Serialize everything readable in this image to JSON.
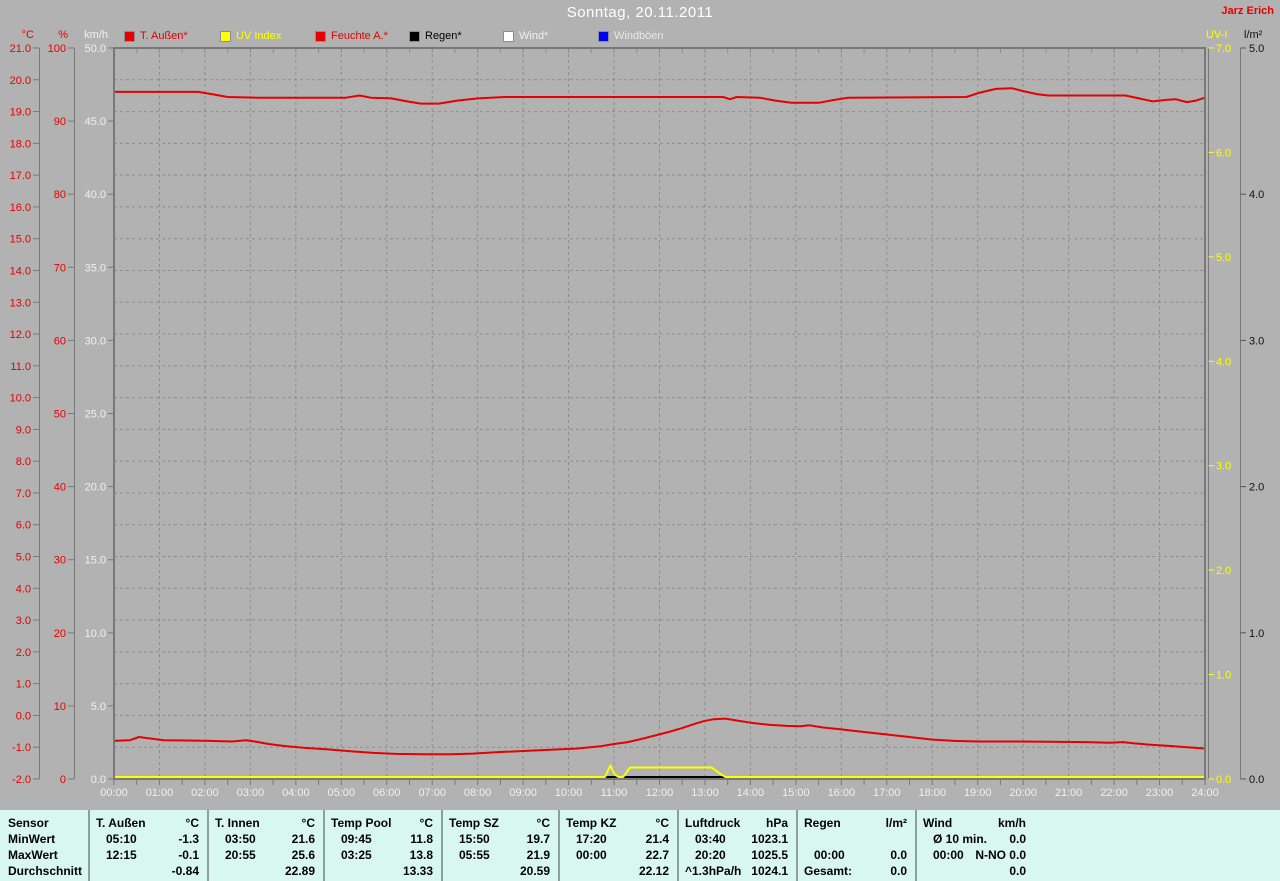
{
  "header": {
    "title": "Sonntag, 20.11.2011",
    "credit": "Jarz Erich"
  },
  "theme": {
    "background": "#b2b2b2",
    "plot_border": "#787878",
    "grid": "#8d8d8d",
    "table_background": "#d8f7f0",
    "red": "#e60000",
    "yellow": "#ffff00",
    "white": "#ffffff",
    "blue": "#0000ff",
    "black": "#000000",
    "x_label_color": "#f0f0f0"
  },
  "legend": {
    "items": [
      {
        "id": "t-aussen",
        "label": "T. Außen*",
        "swatch_color": "#e60000",
        "text_color": "#e60000"
      },
      {
        "id": "uv-index",
        "label": "UV Index",
        "swatch_color": "#ffff00",
        "text_color": "#ffff00"
      },
      {
        "id": "feuchte-a",
        "label": "Feuchte A.*",
        "swatch_color": "#e60000",
        "text_color": "#e60000"
      },
      {
        "id": "regen",
        "label": "Regen*",
        "swatch_color": "#000000",
        "text_color": "#000000"
      },
      {
        "id": "wind",
        "label": "Wind*",
        "swatch_color": "#ffffff",
        "text_color": "#f0f0f0"
      },
      {
        "id": "windboeen",
        "label": "Windböen",
        "swatch_color": "#0000ff",
        "text_color": "#e8e8e8"
      }
    ]
  },
  "chart_data": {
    "type": "line",
    "title": "Sonntag, 20.11.2011",
    "x_axis": {
      "min": 0,
      "max": 24,
      "grid_step_hours": 1,
      "tick_step_hours": 0.5,
      "labels": [
        "00:00",
        "01:00",
        "02:00",
        "03:00",
        "04:00",
        "05:00",
        "06:00",
        "07:00",
        "08:00",
        "09:00",
        "10:00",
        "11:00",
        "12:00",
        "13:00",
        "14:00",
        "15:00",
        "16:00",
        "17:00",
        "18:00",
        "19:00",
        "20:00",
        "21:00",
        "22:00",
        "23:00",
        "24:00"
      ]
    },
    "axes": {
      "temp": {
        "label": "°C",
        "side": "left",
        "min": -2,
        "max": 21,
        "step": 1,
        "color": "#e60000",
        "tick_labels": [
          "21.0",
          "20.0",
          "19.0",
          "18.0",
          "17.0",
          "16.0",
          "15.0",
          "14.0",
          "13.0",
          "12.0",
          "11.0",
          "10.0",
          "9.0",
          "8.0",
          "7.0",
          "6.0",
          "5.0",
          "4.0",
          "3.0",
          "2.0",
          "1.0",
          "0.0",
          "-1.0",
          "-2.0"
        ]
      },
      "humidity": {
        "label": "%",
        "side": "left",
        "min": 0,
        "max": 100,
        "step": 10,
        "color": "#e60000",
        "tick_labels": [
          "100",
          "90",
          "80",
          "70",
          "60",
          "50",
          "40",
          "30",
          "20",
          "10",
          "0"
        ]
      },
      "windspeed": {
        "label": "km/h",
        "side": "left",
        "min": 0,
        "max": 50,
        "step": 5,
        "color": "#f0f0f0",
        "tick_labels": [
          "50.0",
          "45.0",
          "40.0",
          "35.0",
          "30.0",
          "25.0",
          "20.0",
          "15.0",
          "10.0",
          "5.0",
          "0.0"
        ]
      },
      "uv": {
        "label": "UV-I",
        "side": "right",
        "min": 0,
        "max": 7,
        "step": 1,
        "color": "#ffff00",
        "tick_labels": [
          "7.0",
          "6.0",
          "5.0",
          "4.0",
          "3.0",
          "2.0",
          "1.0",
          "0.0"
        ]
      },
      "rain": {
        "label": "l/m²",
        "side": "right",
        "min": 0,
        "max": 5,
        "step": 1,
        "color": "#111111",
        "tick_labels": [
          "5.0",
          "4.0",
          "3.0",
          "2.0",
          "1.0",
          "0.0"
        ]
      }
    },
    "grid": {
      "horizontal_step_temp": 1,
      "vertical_step_hours": 1,
      "style": "dashed"
    },
    "series": [
      {
        "name": "Windböen",
        "axis": "windspeed",
        "color": "#0000ff",
        "width": 2,
        "points": [
          [
            0,
            0
          ],
          [
            24,
            0
          ]
        ]
      },
      {
        "name": "Wind*",
        "axis": "windspeed",
        "color": "#ffffff",
        "width": 2,
        "points": [
          [
            0,
            0
          ],
          [
            24,
            0
          ]
        ]
      },
      {
        "name": "Regen*",
        "axis": "rain",
        "color": "#000000",
        "width": 2,
        "points": [
          [
            0,
            0
          ],
          [
            24,
            0
          ]
        ]
      },
      {
        "name": "UV Index",
        "axis": "uv",
        "color": "#ffff00",
        "width": 2,
        "points": [
          [
            0,
            0
          ],
          [
            10.8,
            0
          ],
          [
            10.92,
            0.13
          ],
          [
            11.02,
            0.04
          ],
          [
            11.1,
            0
          ],
          [
            11.2,
            0
          ],
          [
            11.35,
            0.11
          ],
          [
            13.15,
            0.11
          ],
          [
            13.3,
            0.06
          ],
          [
            13.45,
            0
          ],
          [
            24,
            0
          ]
        ]
      },
      {
        "name": "Feuchte A.*",
        "axis": "humidity",
        "color": "#e60000",
        "width": 2,
        "points": [
          [
            0,
            94.0
          ],
          [
            1.85,
            94.0
          ],
          [
            2.15,
            93.7
          ],
          [
            2.5,
            93.3
          ],
          [
            3.2,
            93.2
          ],
          [
            5.1,
            93.2
          ],
          [
            5.4,
            93.5
          ],
          [
            5.65,
            93.2
          ],
          [
            6.1,
            93.1
          ],
          [
            6.45,
            92.7
          ],
          [
            6.75,
            92.4
          ],
          [
            7.15,
            92.4
          ],
          [
            7.55,
            92.8
          ],
          [
            8.0,
            93.1
          ],
          [
            8.6,
            93.3
          ],
          [
            13.4,
            93.3
          ],
          [
            13.55,
            93.0
          ],
          [
            13.7,
            93.3
          ],
          [
            14.2,
            93.2
          ],
          [
            14.55,
            92.8
          ],
          [
            14.9,
            92.5
          ],
          [
            15.5,
            92.5
          ],
          [
            15.85,
            92.9
          ],
          [
            16.15,
            93.2
          ],
          [
            18.75,
            93.3
          ],
          [
            19.05,
            93.9
          ],
          [
            19.4,
            94.4
          ],
          [
            19.75,
            94.5
          ],
          [
            20.0,
            94.1
          ],
          [
            20.3,
            93.7
          ],
          [
            20.55,
            93.5
          ],
          [
            22.25,
            93.5
          ],
          [
            22.55,
            93.1
          ],
          [
            22.85,
            92.7
          ],
          [
            23.15,
            92.9
          ],
          [
            23.35,
            93.0
          ],
          [
            23.6,
            92.6
          ],
          [
            23.8,
            92.8
          ],
          [
            24,
            93.2
          ]
        ]
      },
      {
        "name": "T. Außen*",
        "axis": "temp",
        "color": "#e60000",
        "width": 2,
        "points": [
          [
            0,
            -0.8
          ],
          [
            0.35,
            -0.78
          ],
          [
            0.55,
            -0.68
          ],
          [
            0.75,
            -0.72
          ],
          [
            1.1,
            -0.78
          ],
          [
            1.6,
            -0.79
          ],
          [
            2.1,
            -0.8
          ],
          [
            2.6,
            -0.82
          ],
          [
            2.9,
            -0.78
          ],
          [
            3.1,
            -0.82
          ],
          [
            3.4,
            -0.9
          ],
          [
            3.8,
            -0.97
          ],
          [
            4.2,
            -1.02
          ],
          [
            4.7,
            -1.07
          ],
          [
            5.2,
            -1.13
          ],
          [
            5.7,
            -1.18
          ],
          [
            6.2,
            -1.21
          ],
          [
            6.8,
            -1.22
          ],
          [
            7.4,
            -1.22
          ],
          [
            7.9,
            -1.2
          ],
          [
            8.4,
            -1.16
          ],
          [
            9.0,
            -1.12
          ],
          [
            9.6,
            -1.08
          ],
          [
            10.2,
            -1.04
          ],
          [
            10.7,
            -0.97
          ],
          [
            11.0,
            -0.9
          ],
          [
            11.3,
            -0.84
          ],
          [
            11.6,
            -0.74
          ],
          [
            11.9,
            -0.63
          ],
          [
            12.2,
            -0.52
          ],
          [
            12.5,
            -0.4
          ],
          [
            12.8,
            -0.25
          ],
          [
            13.0,
            -0.17
          ],
          [
            13.2,
            -0.12
          ],
          [
            13.45,
            -0.1
          ],
          [
            13.7,
            -0.16
          ],
          [
            14.0,
            -0.23
          ],
          [
            14.4,
            -0.29
          ],
          [
            14.8,
            -0.33
          ],
          [
            15.1,
            -0.34
          ],
          [
            15.3,
            -0.31
          ],
          [
            15.6,
            -0.38
          ],
          [
            16.0,
            -0.44
          ],
          [
            16.5,
            -0.52
          ],
          [
            17.0,
            -0.6
          ],
          [
            17.5,
            -0.68
          ],
          [
            18.0,
            -0.76
          ],
          [
            18.5,
            -0.8
          ],
          [
            19.0,
            -0.82
          ],
          [
            19.8,
            -0.82
          ],
          [
            20.6,
            -0.83
          ],
          [
            21.4,
            -0.84
          ],
          [
            21.9,
            -0.86
          ],
          [
            22.2,
            -0.84
          ],
          [
            22.45,
            -0.88
          ],
          [
            22.8,
            -0.92
          ],
          [
            23.2,
            -0.96
          ],
          [
            23.5,
            -0.99
          ],
          [
            23.8,
            -1.02
          ],
          [
            24,
            -1.04
          ]
        ]
      }
    ]
  },
  "table": {
    "row_labels": [
      "Sensor",
      "MinWert",
      "MaxWert",
      "Durchschnitt"
    ],
    "sensors": [
      {
        "name": "T. Außen",
        "unit": "°C",
        "min_time": "05:10",
        "min_val": "-1.3",
        "max_time": "12:15",
        "max_val": "-0.1",
        "avg_label": "",
        "avg_val": "-0.84"
      },
      {
        "name": "T. Innen",
        "unit": "°C",
        "min_time": "03:50",
        "min_val": "21.6",
        "max_time": "20:55",
        "max_val": "25.6",
        "avg_label": "",
        "avg_val": "22.89"
      },
      {
        "name": "Temp Pool",
        "unit": "°C",
        "min_time": "09:45",
        "min_val": "11.8",
        "max_time": "03:25",
        "max_val": "13.8",
        "avg_label": "",
        "avg_val": "13.33"
      },
      {
        "name": "Temp SZ",
        "unit": "°C",
        "min_time": "15:50",
        "min_val": "19.7",
        "max_time": "05:55",
        "max_val": "21.9",
        "avg_label": "",
        "avg_val": "20.59"
      },
      {
        "name": "Temp KZ",
        "unit": "°C",
        "min_time": "17:20",
        "min_val": "21.4",
        "max_time": "00:00",
        "max_val": "22.7",
        "avg_label": "",
        "avg_val": "22.12"
      },
      {
        "name": "Luftdruck",
        "unit": "hPa",
        "min_time": "03:40",
        "min_val": "1023.1",
        "max_time": "20:20",
        "max_val": "1025.5",
        "avg_label": "^1.3hPa/h",
        "avg_val": "1024.1"
      },
      {
        "name": "Regen",
        "unit": "l/m²",
        "min_time": "",
        "min_val": "",
        "max_time": "00:00",
        "max_val": "0.0",
        "avg_label": "Gesamt:",
        "avg_val": "0.0"
      },
      {
        "name": "Wind",
        "unit": "km/h",
        "min_time": "Ø 10 min.",
        "min_val": "0.0",
        "max_time": "00:00",
        "max_val": "N-NO 0.0",
        "avg_label": "",
        "avg_val": "0.0"
      }
    ]
  }
}
